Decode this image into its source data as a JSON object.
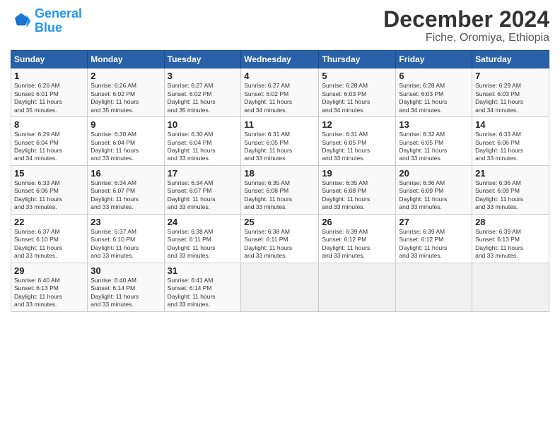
{
  "header": {
    "logo_line1": "General",
    "logo_line2": "Blue",
    "month": "December 2024",
    "location": "Fiche, Oromiya, Ethiopia"
  },
  "weekdays": [
    "Sunday",
    "Monday",
    "Tuesday",
    "Wednesday",
    "Thursday",
    "Friday",
    "Saturday"
  ],
  "weeks": [
    [
      {
        "day": "1",
        "info": "Sunrise: 6:26 AM\nSunset: 6:01 PM\nDaylight: 11 hours\nand 35 minutes."
      },
      {
        "day": "2",
        "info": "Sunrise: 6:26 AM\nSunset: 6:02 PM\nDaylight: 11 hours\nand 35 minutes."
      },
      {
        "day": "3",
        "info": "Sunrise: 6:27 AM\nSunset: 6:02 PM\nDaylight: 11 hours\nand 35 minutes."
      },
      {
        "day": "4",
        "info": "Sunrise: 6:27 AM\nSunset: 6:02 PM\nDaylight: 11 hours\nand 34 minutes."
      },
      {
        "day": "5",
        "info": "Sunrise: 6:28 AM\nSunset: 6:03 PM\nDaylight: 11 hours\nand 34 minutes."
      },
      {
        "day": "6",
        "info": "Sunrise: 6:28 AM\nSunset: 6:03 PM\nDaylight: 11 hours\nand 34 minutes."
      },
      {
        "day": "7",
        "info": "Sunrise: 6:29 AM\nSunset: 6:03 PM\nDaylight: 11 hours\nand 34 minutes."
      }
    ],
    [
      {
        "day": "8",
        "info": "Sunrise: 6:29 AM\nSunset: 6:04 PM\nDaylight: 11 hours\nand 34 minutes."
      },
      {
        "day": "9",
        "info": "Sunrise: 6:30 AM\nSunset: 6:04 PM\nDaylight: 11 hours\nand 33 minutes."
      },
      {
        "day": "10",
        "info": "Sunrise: 6:30 AM\nSunset: 6:04 PM\nDaylight: 11 hours\nand 33 minutes."
      },
      {
        "day": "11",
        "info": "Sunrise: 6:31 AM\nSunset: 6:05 PM\nDaylight: 11 hours\nand 33 minutes."
      },
      {
        "day": "12",
        "info": "Sunrise: 6:31 AM\nSunset: 6:05 PM\nDaylight: 11 hours\nand 33 minutes."
      },
      {
        "day": "13",
        "info": "Sunrise: 6:32 AM\nSunset: 6:05 PM\nDaylight: 11 hours\nand 33 minutes."
      },
      {
        "day": "14",
        "info": "Sunrise: 6:33 AM\nSunset: 6:06 PM\nDaylight: 11 hours\nand 33 minutes."
      }
    ],
    [
      {
        "day": "15",
        "info": "Sunrise: 6:33 AM\nSunset: 6:06 PM\nDaylight: 11 hours\nand 33 minutes."
      },
      {
        "day": "16",
        "info": "Sunrise: 6:34 AM\nSunset: 6:07 PM\nDaylight: 11 hours\nand 33 minutes."
      },
      {
        "day": "17",
        "info": "Sunrise: 6:34 AM\nSunset: 6:07 PM\nDaylight: 11 hours\nand 33 minutes."
      },
      {
        "day": "18",
        "info": "Sunrise: 6:35 AM\nSunset: 6:08 PM\nDaylight: 11 hours\nand 33 minutes."
      },
      {
        "day": "19",
        "info": "Sunrise: 6:35 AM\nSunset: 6:08 PM\nDaylight: 11 hours\nand 33 minutes."
      },
      {
        "day": "20",
        "info": "Sunrise: 6:36 AM\nSunset: 6:09 PM\nDaylight: 11 hours\nand 33 minutes."
      },
      {
        "day": "21",
        "info": "Sunrise: 6:36 AM\nSunset: 6:09 PM\nDaylight: 11 hours\nand 33 minutes."
      }
    ],
    [
      {
        "day": "22",
        "info": "Sunrise: 6:37 AM\nSunset: 6:10 PM\nDaylight: 11 hours\nand 33 minutes."
      },
      {
        "day": "23",
        "info": "Sunrise: 6:37 AM\nSunset: 6:10 PM\nDaylight: 11 hours\nand 33 minutes."
      },
      {
        "day": "24",
        "info": "Sunrise: 6:38 AM\nSunset: 6:11 PM\nDaylight: 11 hours\nand 33 minutes."
      },
      {
        "day": "25",
        "info": "Sunrise: 6:38 AM\nSunset: 6:11 PM\nDaylight: 11 hours\nand 33 minutes."
      },
      {
        "day": "26",
        "info": "Sunrise: 6:39 AM\nSunset: 6:12 PM\nDaylight: 11 hours\nand 33 minutes."
      },
      {
        "day": "27",
        "info": "Sunrise: 6:39 AM\nSunset: 6:12 PM\nDaylight: 11 hours\nand 33 minutes."
      },
      {
        "day": "28",
        "info": "Sunrise: 6:39 AM\nSunset: 6:13 PM\nDaylight: 11 hours\nand 33 minutes."
      }
    ],
    [
      {
        "day": "29",
        "info": "Sunrise: 6:40 AM\nSunset: 6:13 PM\nDaylight: 11 hours\nand 33 minutes."
      },
      {
        "day": "30",
        "info": "Sunrise: 6:40 AM\nSunset: 6:14 PM\nDaylight: 11 hours\nand 33 minutes."
      },
      {
        "day": "31",
        "info": "Sunrise: 6:41 AM\nSunset: 6:14 PM\nDaylight: 11 hours\nand 33 minutes."
      },
      {
        "day": "",
        "info": ""
      },
      {
        "day": "",
        "info": ""
      },
      {
        "day": "",
        "info": ""
      },
      {
        "day": "",
        "info": ""
      }
    ]
  ]
}
